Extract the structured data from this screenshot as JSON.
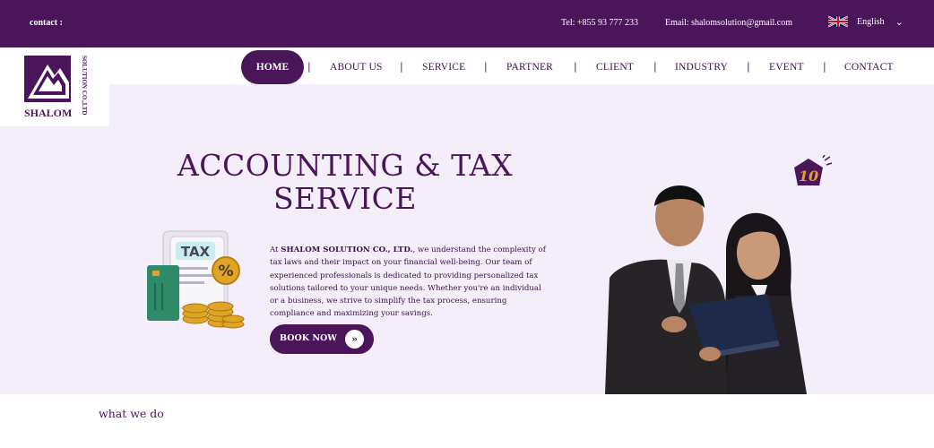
{
  "topbar": {
    "contact": "contact :",
    "tel": "Tel: +855 93 777 233",
    "email": "Email: shalomsolution@gmail.com",
    "language": "English"
  },
  "logo": {
    "name": "SHALOM",
    "subtitle": "SOLUTION CO.,LTD"
  },
  "nav": {
    "items": [
      "HOME",
      "ABOUT US",
      "SERVICE",
      "PARTNER",
      "CLIENT",
      "INDUSTRY",
      "EVENT",
      "CONTACT"
    ],
    "separator": "|",
    "active": "HOME"
  },
  "hero": {
    "title_line1": "ACCOUNTING & TAX",
    "title_line2": "SERVICE",
    "desc_prefix": "At ",
    "desc_company": "SHALOM SOLUTION CO., LTD.",
    "desc_body": ", we understand the complexity of tax laws and their impact on your financial well-being. Our team of experienced professionals is dedicated to providing personalized tax solutions tailored to your unique needs. Whether you're an individual or a business, we strive to simplify the tax process, ensuring compliance and maximizing your savings.",
    "button": "BOOK NOW",
    "button_icon": "double-chevron-right-icon",
    "illustration_text": "TAX",
    "illustration_symbol": "%",
    "badge_text": "10"
  },
  "section": {
    "heading": "what we do"
  },
  "colors": {
    "brand_purple": "#4a1559",
    "hero_bg": "#f4edfa",
    "gold": "#e0a526",
    "card_green": "#2e8a68"
  }
}
